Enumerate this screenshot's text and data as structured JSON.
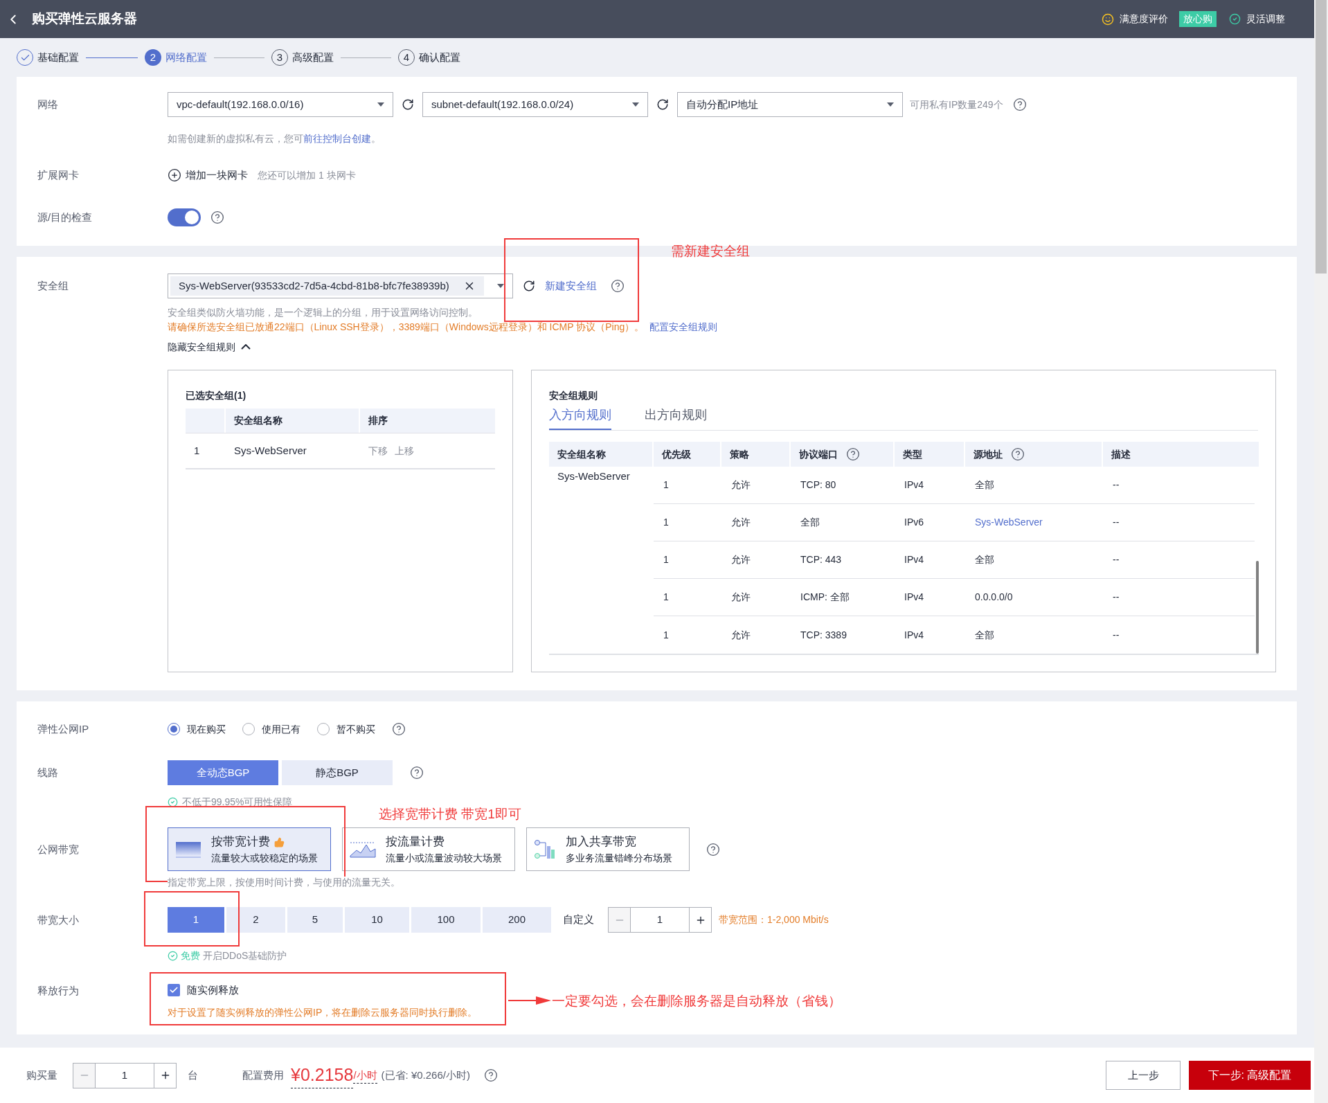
{
  "header": {
    "title": "购买弹性云服务器",
    "satisfaction": "满意度评价",
    "badge": "放心购",
    "flexible": "灵活调整"
  },
  "steps": [
    {
      "label": "基础配置",
      "done": true,
      "current": false
    },
    {
      "number": "2",
      "label": "网络配置",
      "done": false,
      "current": true
    },
    {
      "number": "3",
      "label": "高级配置",
      "done": false,
      "current": false
    },
    {
      "number": "4",
      "label": "确认配置",
      "done": false,
      "current": false
    }
  ],
  "network": {
    "label": "网络",
    "vpc": "vpc-default(192.168.0.0/16)",
    "subnet": "subnet-default(192.168.0.0/24)",
    "ip": "自动分配IP地址",
    "ip_count": "可用私有IP数量249个",
    "hint": "如需创建新的虚拟私有云，您可",
    "hint_link": "前往控制台创建",
    "hint_end": "。"
  },
  "nic": {
    "label": "扩展网卡",
    "add": "增加一块网卡",
    "note": "您还可以增加 1 块网卡"
  },
  "source_check": {
    "label": "源/目的检查",
    "on": true
  },
  "security_group": {
    "label": "安全组",
    "value": "Sys-WebServer(93533cd2-7d5a-4cbd-81b8-bfc7fe38939b)",
    "create_link": "新建安全组",
    "desc": "安全组类似防火墙功能，是一个逻辑上的分组，用于设置网络访问控制。",
    "warning": "请确保所选安全组已放通22端口（Linux SSH登录），3389端口（Windows远程登录）和 ICMP 协议（Ping）。",
    "warning_link": "配置安全组规则",
    "toggle": "隐藏安全组规则",
    "expanded": true
  },
  "selected_groups": {
    "title": "已选安全组(1)",
    "columns": [
      "安全组名称",
      "排序"
    ],
    "rows": [
      {
        "index": "1",
        "name": "Sys-WebServer",
        "actions": [
          "下移",
          "上移"
        ]
      }
    ]
  },
  "rules": {
    "title": "安全组规则",
    "tabs": [
      {
        "label": "入方向规则",
        "selected": true
      },
      {
        "label": "出方向规则",
        "selected": false
      }
    ],
    "columns": [
      {
        "label": "安全组名称",
        "help": false
      },
      {
        "label": "优先级",
        "help": false
      },
      {
        "label": "策略",
        "help": false
      },
      {
        "label": "协议端口",
        "help": true
      },
      {
        "label": "类型",
        "help": false
      },
      {
        "label": "源地址",
        "help": true
      },
      {
        "label": "描述",
        "help": false
      }
    ],
    "group_name": "Sys-WebServer",
    "rows": [
      {
        "priority": "1",
        "policy": "允许",
        "port": "TCP: 80",
        "type": "IPv4",
        "source": "全部",
        "source_link": false,
        "desc": "--"
      },
      {
        "priority": "1",
        "policy": "允许",
        "port": "全部",
        "type": "IPv6",
        "source": "Sys-WebServer",
        "source_link": true,
        "desc": "--"
      },
      {
        "priority": "1",
        "policy": "允许",
        "port": "TCP: 443",
        "type": "IPv4",
        "source": "全部",
        "source_link": false,
        "desc": "--"
      },
      {
        "priority": "1",
        "policy": "允许",
        "port": "ICMP: 全部",
        "type": "IPv4",
        "source": "0.0.0.0/0",
        "source_link": false,
        "desc": "--"
      },
      {
        "priority": "1",
        "policy": "允许",
        "port": "TCP: 3389",
        "type": "IPv4",
        "source": "全部",
        "source_link": false,
        "desc": "--"
      }
    ]
  },
  "eip": {
    "label": "弹性公网IP",
    "options": [
      {
        "label": "现在购买",
        "selected": true
      },
      {
        "label": "使用已有",
        "selected": false
      },
      {
        "label": "暂不购买",
        "selected": false
      }
    ]
  },
  "line": {
    "label": "线路",
    "options": [
      {
        "label": "全动态BGP",
        "selected": true
      },
      {
        "label": "静态BGP",
        "selected": false
      }
    ],
    "guarantee": "不低于99.95%可用性保障"
  },
  "bandwidth": {
    "label": "公网带宽",
    "cards": [
      {
        "kind": "bandwidth",
        "title": "按带宽计费",
        "subtitle": "流量较大或较稳定的场景",
        "selected": true,
        "recommended": true
      },
      {
        "kind": "traffic",
        "title": "按流量计费",
        "subtitle": "流量小或流量波动较大场景",
        "selected": false,
        "recommended": false
      },
      {
        "kind": "shared",
        "title": "加入共享带宽",
        "subtitle": "多业务流量错峰分布场景",
        "selected": false,
        "recommended": false
      }
    ],
    "hint": "指定带宽上限，按使用时间计费，与使用的流量无关。"
  },
  "size": {
    "label": "带宽大小",
    "options": [
      {
        "label": "1",
        "selected": true
      },
      {
        "label": "2",
        "selected": false
      },
      {
        "label": "5",
        "selected": false
      },
      {
        "label": "10",
        "selected": false
      },
      {
        "label": "100",
        "selected": false
      },
      {
        "label": "200",
        "selected": false
      }
    ],
    "custom_label": "自定义",
    "custom_value": "1",
    "range": "带宽范围：1-2,000 Mbit/s",
    "free": "免费",
    "ddos": "开启DDoS基础防护"
  },
  "release": {
    "label": "释放行为",
    "option": "随实例释放",
    "checked": true,
    "note": "对于设置了随实例释放的弹性公网IP，将在删除云服务器同时执行删除。"
  },
  "footer": {
    "qty_label": "购买量",
    "qty": "1",
    "unit": "台",
    "fee_label": "配置费用",
    "price": "¥0.2158",
    "per": "/小时",
    "saved": "(已省: ¥0.266/小时)",
    "prev": "上一步",
    "next": "下一步: 高级配置"
  },
  "annotations": [
    {
      "text": "需新建安全组"
    },
    {
      "text": "选择宽带计费 带宽1即可"
    },
    {
      "text": "一定要勾选，会在删除服务器是自动释放（省钱）"
    }
  ]
}
